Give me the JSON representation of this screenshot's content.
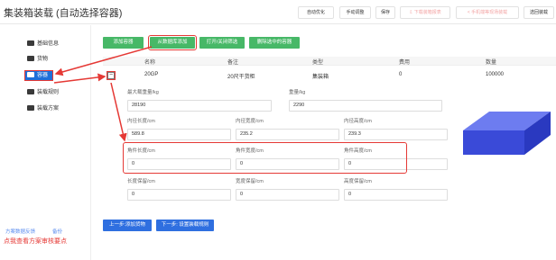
{
  "header": {
    "title": "集装箱装载 (自动选择容器)",
    "buttons": [
      {
        "label": "自动优化",
        "enabled": true
      },
      {
        "label": "手动调整",
        "enabled": true
      },
      {
        "label": "保存",
        "enabled": true
      },
      {
        "label": "下载装箱报表",
        "enabled": false,
        "icon": "download-icon"
      },
      {
        "label": "手机端等现场装载",
        "enabled": false,
        "icon": "share-icon"
      },
      {
        "label": "选回装载",
        "enabled": true
      }
    ]
  },
  "sidebar": {
    "items": [
      "基础信息",
      "货物",
      "容器",
      "装载规则",
      "装载方案"
    ],
    "selected_index": 2,
    "links": [
      "方案数据反馈",
      "备份"
    ],
    "tip": "点我查看方案审核要点"
  },
  "toolbar": {
    "add_container": "添加容器",
    "add_from_db": "从数据库添加",
    "toggle_filter": "打开/关闭筛选",
    "delete_selected": "删除选中的容器"
  },
  "table": {
    "headers": [
      "名称",
      "备注",
      "类型",
      "费用",
      "数量"
    ],
    "row": {
      "expand_symbol": "−",
      "name": "20GP",
      "remark": "20尺干货柜",
      "type": "集装箱",
      "cost": "0",
      "quantity": "100000"
    }
  },
  "details": {
    "max_load_label": "最大载重量/kg",
    "max_load": "28190",
    "weight_label": "重量/kg",
    "weight": "2290",
    "inner_length_label": "内径长度/cm",
    "inner_length": "589.8",
    "inner_width_label": "内径宽度/cm",
    "inner_width": "235.2",
    "inner_height_label": "内径高度/cm",
    "inner_height": "239.3",
    "corner_length_label": "角件长度/cm",
    "corner_length": "0",
    "corner_width_label": "角件宽度/cm",
    "corner_width": "0",
    "corner_height_label": "角件高度/cm",
    "corner_height": "0",
    "reserve_length_label": "长度保留/cm",
    "reserve_length": "0",
    "reserve_width_label": "宽度保留/cm",
    "reserve_width": "0",
    "reserve_height_label": "高度保留/cm",
    "reserve_height": "0"
  },
  "footer": {
    "prev": "上一步:添加货物",
    "next": "下一步: 设置装载规则"
  },
  "colors": {
    "accent": "#2f6fe0",
    "green": "#47b867",
    "highlight": "#e53935",
    "box_top": "#5a6fe8",
    "box_front": "#3f4fe0"
  }
}
